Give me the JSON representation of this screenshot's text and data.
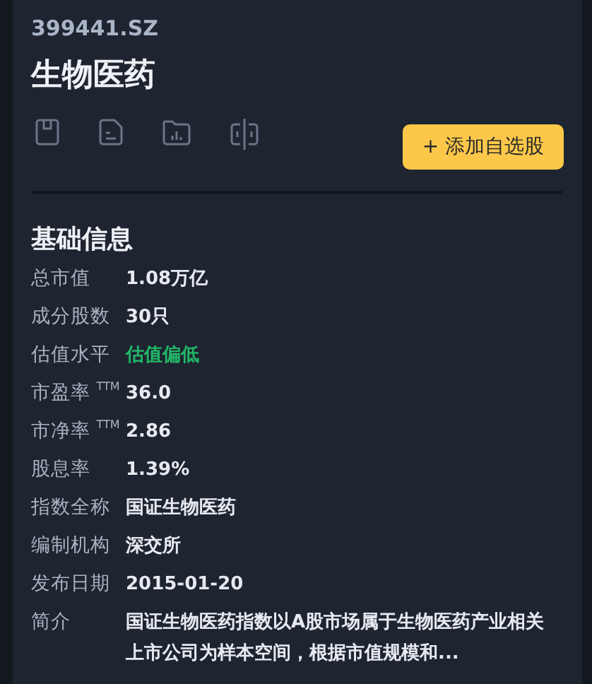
{
  "code": "399441.SZ",
  "name": "生物医药",
  "add_button": "+ 添加自选股",
  "section_title": "基础信息",
  "fields": [
    {
      "label": "总市值",
      "value": "1.08万亿",
      "kind": "plain"
    },
    {
      "label": "成分股数",
      "value": "30只",
      "kind": "plain"
    },
    {
      "label": "估值水平",
      "value": "估值偏低",
      "kind": "highlight"
    },
    {
      "label": "市盈率 $^{TTM}$",
      "value": "36.0",
      "kind": "plain"
    },
    {
      "label": "市净率 $^{TTM}$",
      "value": "2.86",
      "kind": "plain"
    },
    {
      "label": "股息率",
      "value": "1.39%",
      "kind": "plain"
    },
    {
      "label": "指数全称",
      "value": "国证生物医药",
      "kind": "plain"
    },
    {
      "label": "编制机构",
      "value": "深交所",
      "kind": "plain"
    },
    {
      "label": "发布日期",
      "value": "2015-01-20",
      "kind": "plain"
    },
    {
      "label": "简介",
      "value": "国证生物医药指数以A股市场属于生物医药产业相关上市公司为样本空间，根据市值规模和...",
      "kind": "plain"
    }
  ]
}
